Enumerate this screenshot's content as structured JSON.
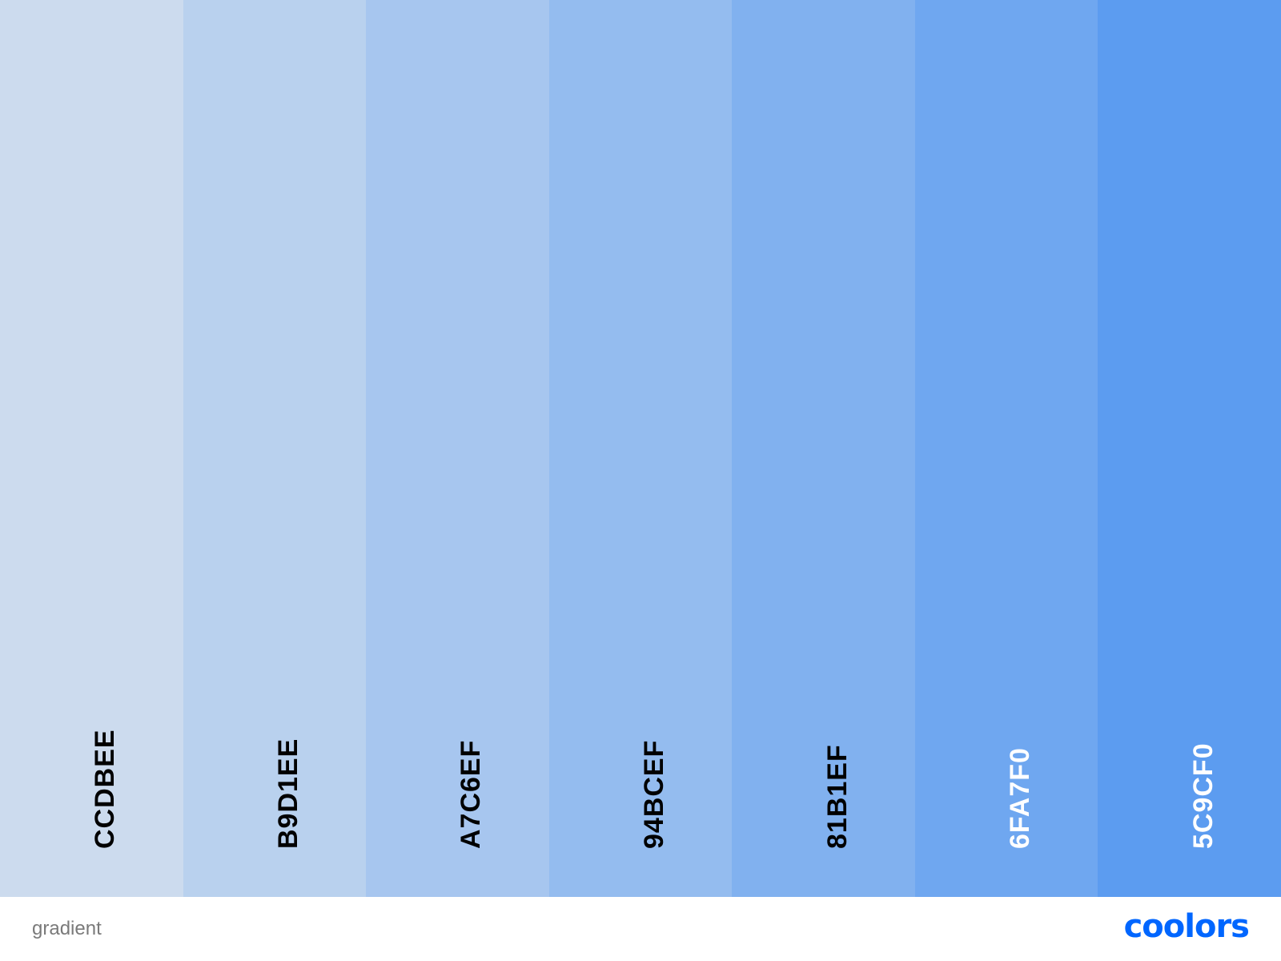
{
  "palette": {
    "swatches": [
      {
        "hex": "CCDBEE",
        "color": "#CCDBEE",
        "text_color": "#000000"
      },
      {
        "hex": "B9D1EE",
        "color": "#B9D1EE",
        "text_color": "#000000"
      },
      {
        "hex": "A7C6EF",
        "color": "#A7C6EF",
        "text_color": "#000000"
      },
      {
        "hex": "94BCEF",
        "color": "#94BCEF",
        "text_color": "#000000"
      },
      {
        "hex": "81B1EF",
        "color": "#81B1EF",
        "text_color": "#000000"
      },
      {
        "hex": "6FA7F0",
        "color": "#6FA7F0",
        "text_color": "#FFFFFF"
      },
      {
        "hex": "5C9CF0",
        "color": "#5C9CF0",
        "text_color": "#FFFFFF"
      }
    ]
  },
  "footer": {
    "palette_name": "gradient",
    "logo_text": "coolors",
    "logo_color": "#0066FF"
  }
}
